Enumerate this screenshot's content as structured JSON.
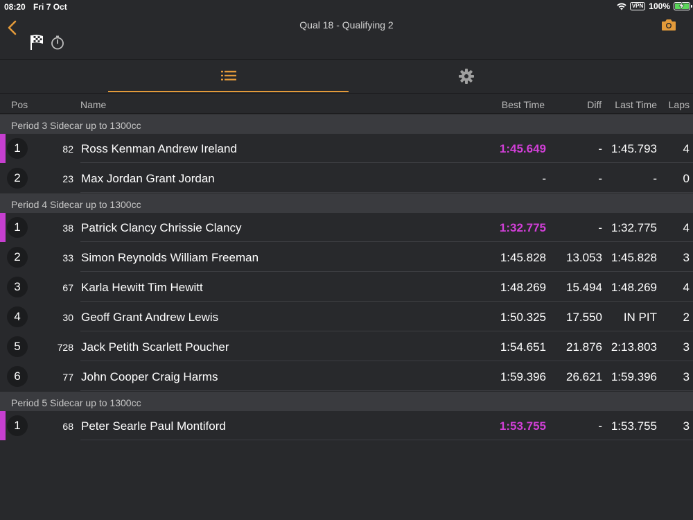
{
  "status": {
    "time": "08:20",
    "date": "Fri 7 Oct",
    "vpn": "VPN",
    "battery": "100%"
  },
  "nav": {
    "title": "Qual 18 - Qualifying 2"
  },
  "columns": {
    "pos": "Pos",
    "name": "Name",
    "best": "Best Time",
    "diff": "Diff",
    "last": "Last Time",
    "laps": "Laps"
  },
  "sections": [
    {
      "title": "Period 3 Sidecar up to 1300cc",
      "rows": [
        {
          "pos": "1",
          "num": "82",
          "name": "Ross Kenman Andrew Ireland",
          "best": "1:45.649",
          "diff": "-",
          "last": "1:45.793",
          "laps": "4",
          "leader": true
        },
        {
          "pos": "2",
          "num": "23",
          "name": "Max Jordan Grant Jordan",
          "best": "-",
          "diff": "-",
          "last": "-",
          "laps": "0",
          "leader": false
        }
      ]
    },
    {
      "title": "Period 4 Sidecar up to 1300cc",
      "rows": [
        {
          "pos": "1",
          "num": "38",
          "name": "Patrick Clancy Chrissie Clancy",
          "best": "1:32.775",
          "diff": "-",
          "last": "1:32.775",
          "laps": "4",
          "leader": true
        },
        {
          "pos": "2",
          "num": "33",
          "name": "Simon Reynolds William Freeman",
          "best": "1:45.828",
          "diff": "13.053",
          "last": "1:45.828",
          "laps": "3",
          "leader": false
        },
        {
          "pos": "3",
          "num": "67",
          "name": "Karla Hewitt Tim Hewitt",
          "best": "1:48.269",
          "diff": "15.494",
          "last": "1:48.269",
          "laps": "4",
          "leader": false
        },
        {
          "pos": "4",
          "num": "30",
          "name": "Geoff Grant Andrew Lewis",
          "best": "1:50.325",
          "diff": "17.550",
          "last": "IN PIT",
          "laps": "2",
          "leader": false
        },
        {
          "pos": "5",
          "num": "728",
          "name": "Jack Petith Scarlett Poucher",
          "best": "1:54.651",
          "diff": "21.876",
          "last": "2:13.803",
          "laps": "3",
          "leader": false
        },
        {
          "pos": "6",
          "num": "77",
          "name": "John Cooper Craig Harms",
          "best": "1:59.396",
          "diff": "26.621",
          "last": "1:59.396",
          "laps": "3",
          "leader": false
        }
      ]
    },
    {
      "title": "Period 5 Sidecar up to 1300cc",
      "rows": [
        {
          "pos": "1",
          "num": "68",
          "name": "Peter Searle Paul Montiford",
          "best": "1:53.755",
          "diff": "-",
          "last": "1:53.755",
          "laps": "3",
          "leader": true
        }
      ]
    }
  ],
  "colors": {
    "accent": "#e39a3a",
    "fastest": "#d23fd8",
    "background": "#28292c",
    "section_bg": "#3a3b3f"
  },
  "icons": {
    "back": "chevron-left-icon",
    "flag": "checkered-flag-icon",
    "timer": "stopwatch-icon",
    "camera": "camera-icon",
    "list_tab": "list-icon",
    "settings_tab": "gear-icon"
  }
}
